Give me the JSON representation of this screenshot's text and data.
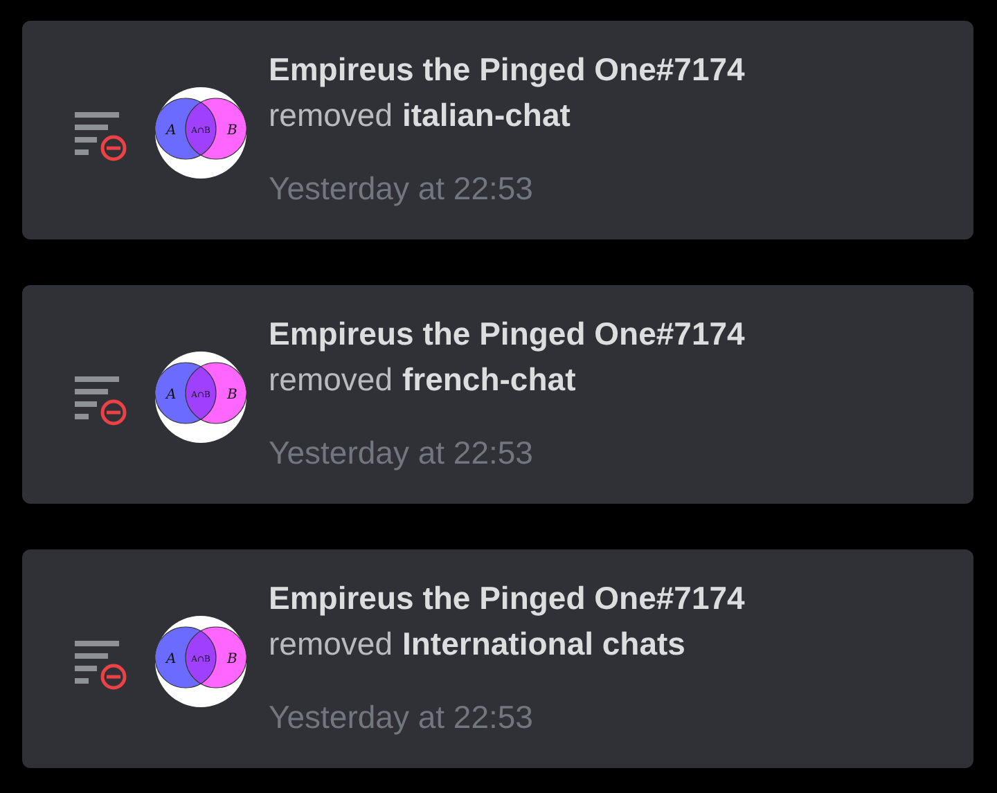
{
  "entries": [
    {
      "user": "Empireus the Pinged One#7174",
      "action": "removed",
      "target": "italian-chat",
      "time": "Yesterday at 22:53",
      "avatar_labels": [
        "A",
        "A∩B",
        "B"
      ]
    },
    {
      "user": "Empireus the Pinged One#7174",
      "action": "removed",
      "target": "french-chat",
      "time": "Yesterday at 22:53",
      "avatar_labels": [
        "A",
        "A∩B",
        "B"
      ]
    },
    {
      "user": "Empireus the Pinged One#7174",
      "action": "removed",
      "target": "International chats",
      "time": "Yesterday at 22:53",
      "avatar_labels": [
        "A",
        "A∩B",
        "B"
      ]
    }
  ]
}
